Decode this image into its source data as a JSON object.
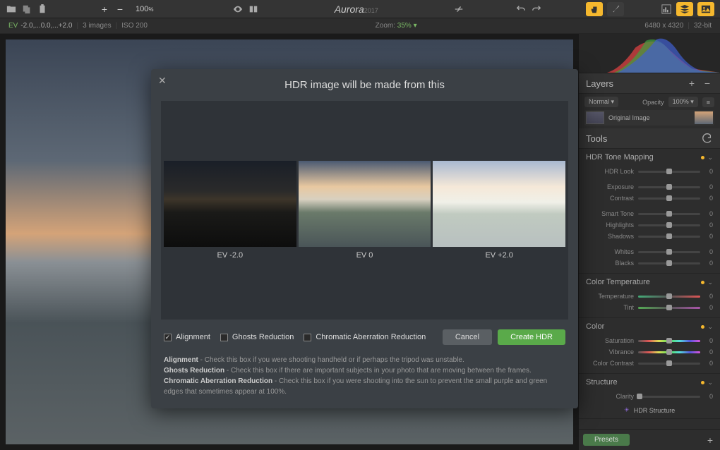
{
  "topbar": {
    "zoom": "100",
    "zoom_suffix": "%",
    "app_name": "Aurora",
    "app_year": "2017"
  },
  "infobar": {
    "ev_label": "EV",
    "ev_values": "-2.0,...0.0,...+2.0",
    "images": "3 images",
    "iso": "ISO 200",
    "zoom_label": "Zoom:",
    "zoom_value": "35%",
    "dimensions": "6480 x 4320",
    "bits": "32-bit"
  },
  "layers_panel": {
    "title": "Layers",
    "blend": "Normal",
    "opacity_label": "Opacity",
    "opacity_value": "100%",
    "layer_name": "Original Image"
  },
  "tools_panel": {
    "title": "Tools"
  },
  "groups": {
    "hdr": {
      "title": "HDR Tone Mapping",
      "sliders": [
        {
          "label": "HDR Look",
          "value": "0"
        },
        {
          "label": "Exposure",
          "value": "0"
        },
        {
          "label": "Contrast",
          "value": "0"
        },
        {
          "label": "Smart Tone",
          "value": "0"
        },
        {
          "label": "Highlights",
          "value": "0"
        },
        {
          "label": "Shadows",
          "value": "0"
        },
        {
          "label": "Whites",
          "value": "0"
        },
        {
          "label": "Blacks",
          "value": "0"
        }
      ]
    },
    "temp": {
      "title": "Color Temperature",
      "sliders": [
        {
          "label": "Temperature",
          "value": "0"
        },
        {
          "label": "Tint",
          "value": "0"
        }
      ]
    },
    "color": {
      "title": "Color",
      "sliders": [
        {
          "label": "Saturation",
          "value": "0"
        },
        {
          "label": "Vibrance",
          "value": "0"
        },
        {
          "label": "Color Contrast",
          "value": "0"
        }
      ]
    },
    "structure": {
      "title": "Structure",
      "sliders": [
        {
          "label": "Clarity",
          "value": "0"
        }
      ],
      "hdr_structure": "HDR Structure"
    }
  },
  "presets": "Presets",
  "modal": {
    "title": "HDR image will be made from this",
    "ev_labels": [
      "EV -2.0",
      "EV 0",
      "EV +2.0"
    ],
    "opts": {
      "alignment": "Alignment",
      "ghosts": "Ghosts Reduction",
      "chroma": "Chromatic Aberration Reduction"
    },
    "cancel": "Cancel",
    "create": "Create HDR",
    "help": {
      "alignment_b": "Alignment",
      "alignment_t": " - Check this box if you were shooting handheld or if perhaps the tripod was unstable.",
      "ghosts_b": "Ghosts Reduction",
      "ghosts_t": " - Check this box if there are important subjects in your photo that are moving between the frames.",
      "chroma_b": "Chromatic Aberration Reduction",
      "chroma_t": " - Check this box if you were shooting into the sun to prevent the small purple and green edges that sometimes appear at 100%."
    }
  }
}
